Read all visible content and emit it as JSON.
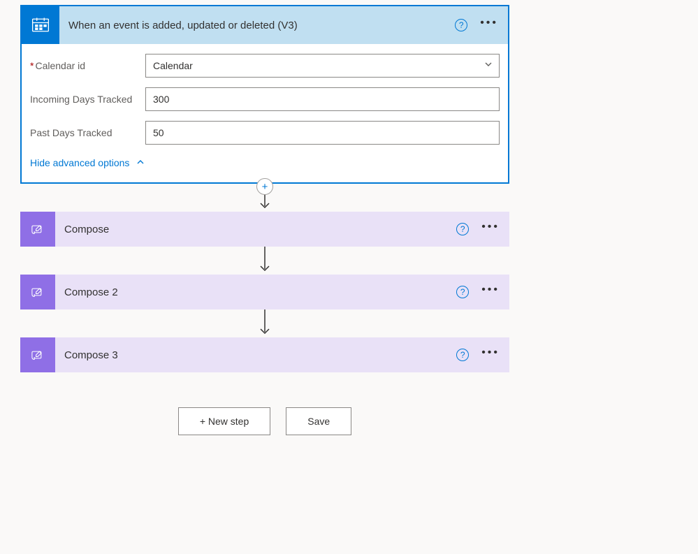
{
  "trigger": {
    "title": "When an event is added, updated or deleted (V3)",
    "fields": {
      "calendar_label": "Calendar id",
      "calendar_value": "Calendar",
      "incoming_label": "Incoming Days Tracked",
      "incoming_value": "300",
      "past_label": "Past Days Tracked",
      "past_value": "50"
    },
    "advanced_toggle": "Hide advanced options"
  },
  "steps": [
    {
      "title": "Compose"
    },
    {
      "title": "Compose 2"
    },
    {
      "title": "Compose 3"
    }
  ],
  "buttons": {
    "new_step": "+ New step",
    "save": "Save"
  }
}
